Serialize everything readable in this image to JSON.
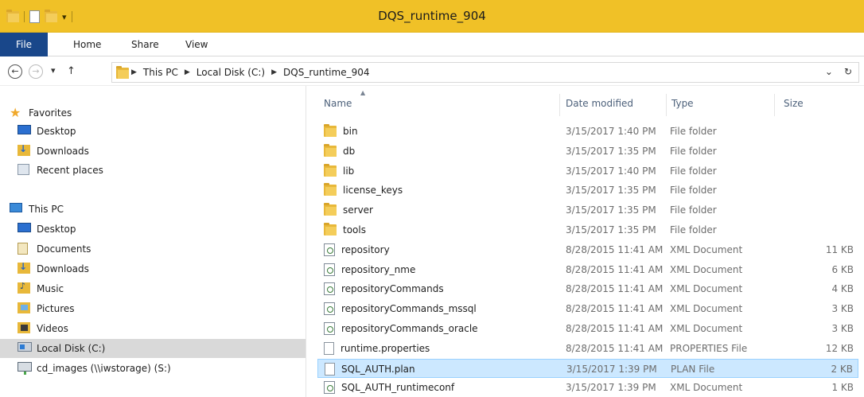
{
  "window": {
    "title": "DQS_runtime_904"
  },
  "ribbon": {
    "tabs": [
      "File",
      "Home",
      "Share",
      "View"
    ]
  },
  "address": {
    "crumbs": [
      "This PC",
      "Local Disk (C:)",
      "DQS_runtime_904"
    ]
  },
  "nav": {
    "favorites_label": "Favorites",
    "favorites": [
      "Desktop",
      "Downloads",
      "Recent places"
    ],
    "thispc_label": "This PC",
    "thispc_items": [
      "Desktop",
      "Documents",
      "Downloads",
      "Music",
      "Pictures",
      "Videos",
      "Local Disk (C:)",
      "cd_images (\\\\iwstorage) (S:)"
    ]
  },
  "columns": {
    "name": "Name",
    "date": "Date modified",
    "type": "Type",
    "size": "Size"
  },
  "files": [
    {
      "name": "bin",
      "date": "3/15/2017 1:40 PM",
      "type": "File folder",
      "size": "",
      "icon": "folder"
    },
    {
      "name": "db",
      "date": "3/15/2017 1:35 PM",
      "type": "File folder",
      "size": "",
      "icon": "folder"
    },
    {
      "name": "lib",
      "date": "3/15/2017 1:40 PM",
      "type": "File folder",
      "size": "",
      "icon": "folder"
    },
    {
      "name": "license_keys",
      "date": "3/15/2017 1:35 PM",
      "type": "File folder",
      "size": "",
      "icon": "folder"
    },
    {
      "name": "server",
      "date": "3/15/2017 1:35 PM",
      "type": "File folder",
      "size": "",
      "icon": "folder"
    },
    {
      "name": "tools",
      "date": "3/15/2017 1:35 PM",
      "type": "File folder",
      "size": "",
      "icon": "folder"
    },
    {
      "name": "repository",
      "date": "8/28/2015 11:41 AM",
      "type": "XML Document",
      "size": "11 KB",
      "icon": "xml"
    },
    {
      "name": "repository_nme",
      "date": "8/28/2015 11:41 AM",
      "type": "XML Document",
      "size": "6 KB",
      "icon": "xml"
    },
    {
      "name": "repositoryCommands",
      "date": "8/28/2015 11:41 AM",
      "type": "XML Document",
      "size": "4 KB",
      "icon": "xml"
    },
    {
      "name": "repositoryCommands_mssql",
      "date": "8/28/2015 11:41 AM",
      "type": "XML Document",
      "size": "3 KB",
      "icon": "xml"
    },
    {
      "name": "repositoryCommands_oracle",
      "date": "8/28/2015 11:41 AM",
      "type": "XML Document",
      "size": "3 KB",
      "icon": "xml"
    },
    {
      "name": "runtime.properties",
      "date": "8/28/2015 11:41 AM",
      "type": "PROPERTIES File",
      "size": "12 KB",
      "icon": "file"
    },
    {
      "name": "SQL_AUTH.plan",
      "date": "3/15/2017 1:39 PM",
      "type": "PLAN File",
      "size": "2 KB",
      "icon": "file"
    },
    {
      "name": "SQL_AUTH_runtimeconf",
      "date": "3/15/2017 1:39 PM",
      "type": "XML Document",
      "size": "1 KB",
      "icon": "xml"
    }
  ],
  "colors": {
    "titlebar": "#f0c127",
    "file_tab": "#19478a",
    "selection": "#cce8ff",
    "nav_selected": "#d9d9d9"
  }
}
